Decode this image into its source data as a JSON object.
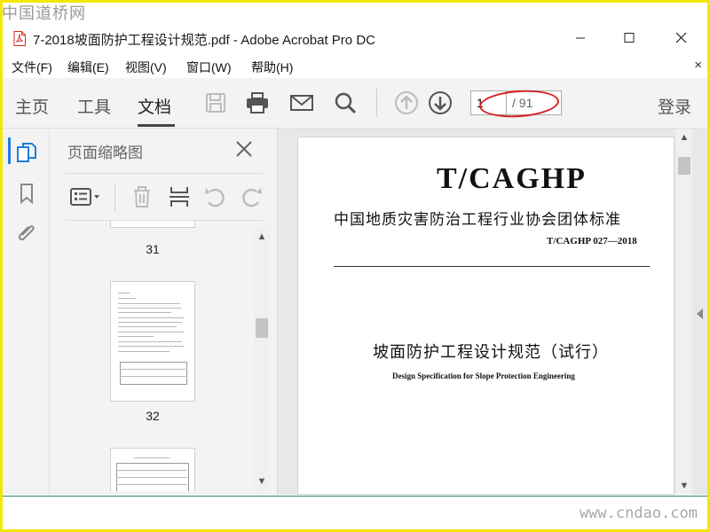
{
  "watermark_top": "中国道桥网",
  "watermark_bottom": "www.cndao.com",
  "window": {
    "title": "7-2018坡面防护工程设计规范.pdf - Adobe Acrobat Pro DC",
    "minimize_glyph": "—",
    "maximize_glyph": "☐",
    "close_glyph": "✕"
  },
  "menu": {
    "items": [
      "文件(F)",
      "编辑(E)",
      "视图(V)",
      "窗口(W)",
      "帮助(H)"
    ],
    "close_glyph": "×"
  },
  "toolbar": {
    "tabs": [
      "主页",
      "工具",
      "文档"
    ],
    "active_tab": "文档",
    "icons": [
      "save-icon",
      "print-icon",
      "mail-icon",
      "search-icon",
      "page-up-icon",
      "page-down-icon"
    ],
    "current_page": "1",
    "total_pages": "/ 91",
    "login_label": "登录"
  },
  "left_rail": {
    "icons": [
      "page-thumbnails-icon",
      "bookmark-icon",
      "attachment-icon"
    ]
  },
  "thumbnail_panel": {
    "title": "页面缩略图",
    "tool_icons": [
      "options-icon",
      "delete-icon",
      "insert-icon",
      "rotate-left-icon",
      "rotate-right-icon"
    ],
    "pages": [
      "31",
      "32"
    ]
  },
  "document": {
    "code": "T/CAGHP",
    "organization": "中国地质灾害防治工程行业协会团体标准",
    "standard_number": "T/CAGHP 027—2018",
    "title": "坡面防护工程设计规范（试行）",
    "subtitle": "Design Specification for Slope Protection Engineering"
  },
  "colors": {
    "frame": "#f5e60a",
    "accent": "#1f7ed6",
    "annotation": "#d42020",
    "pdf_red": "#d9261c"
  }
}
